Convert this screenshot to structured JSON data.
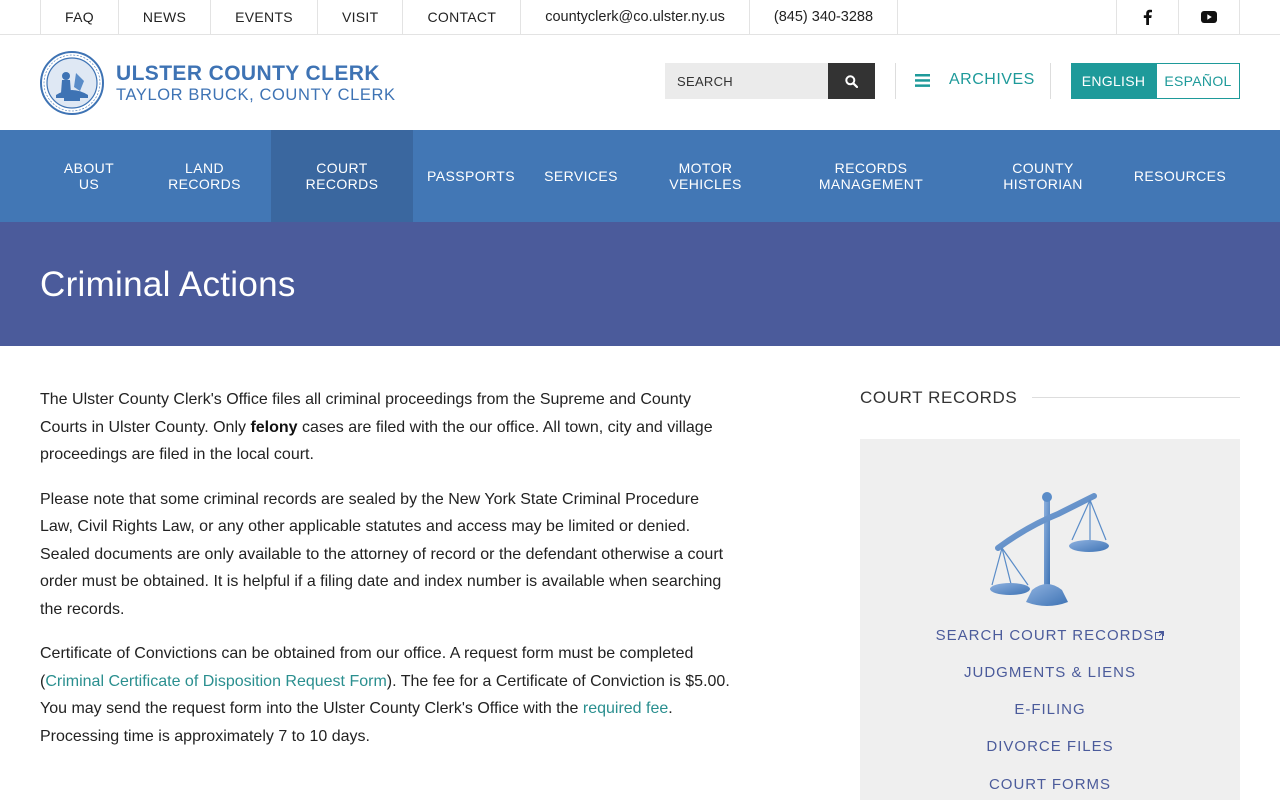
{
  "topbar": {
    "links": [
      "FAQ",
      "NEWS",
      "EVENTS",
      "VISIT",
      "CONTACT"
    ],
    "email": "countyclerk@co.ulster.ny.us",
    "phone": "(845) 340-3288",
    "social": [
      "facebook-icon",
      "youtube-icon"
    ]
  },
  "header": {
    "title": "ULSTER COUNTY CLERK",
    "subtitle": "TAYLOR BRUCK, COUNTY CLERK",
    "search_placeholder": "SEARCH",
    "archives_label": "ARCHIVES",
    "lang_english": "ENGLISH",
    "lang_spanish": "ESPAÑOL"
  },
  "nav": {
    "items": [
      {
        "label": "ABOUT\nUS"
      },
      {
        "label": "LAND\nRECORDS"
      },
      {
        "label": "COURT\nRECORDS",
        "active": true
      },
      {
        "label": "PASSPORTS"
      },
      {
        "label": "SERVICES"
      },
      {
        "label": "MOTOR\nVEHICLES"
      },
      {
        "label": "RECORDS\nMANAGEMENT"
      },
      {
        "label": "COUNTY\nHISTORIAN"
      },
      {
        "label": "RESOURCES"
      }
    ]
  },
  "page": {
    "title": "Criminal Actions",
    "p1_a": "The Ulster County Clerk's Office files all criminal proceedings from the Supreme and County Courts in Ulster County.  Only ",
    "p1_bold": "felony",
    "p1_b": " cases are filed with the our office. All town, city and village proceedings are filed in the local court.",
    "p2": "Please note that some criminal records are sealed by the New York State Criminal Procedure Law, Civil Rights Law, or any other applicable statutes and access may be limited or denied. Sealed documents are only available to the attorney of record or the defendant otherwise a court order must be obtained. It is helpful if a filing date and index number is available when searching the records.",
    "p3_a": "Certificate of Convictions can be obtained from our office. A request form must be completed (",
    "p3_link1": "Criminal Certificate of Disposition Request Form",
    "p3_b": "). The fee for a Certificate of Conviction is $5.00. You may send the request form into the Ulster County Clerk's Office with the ",
    "p3_link2": "required fee",
    "p3_c": ". Processing time is approximately 7 to 10 days."
  },
  "sidebar": {
    "title": "COURT RECORDS",
    "links": [
      "SEARCH COURT RECORDS",
      "JUDGMENTS & LIENS",
      "E-FILING",
      "DIVORCE FILES",
      "COURT FORMS"
    ]
  },
  "colors": {
    "brand_blue": "#3e73b4",
    "nav_blue": "#4277b5",
    "nav_active": "#3a679f",
    "title_band": "#4b5b9b",
    "teal": "#1e9a9a"
  }
}
